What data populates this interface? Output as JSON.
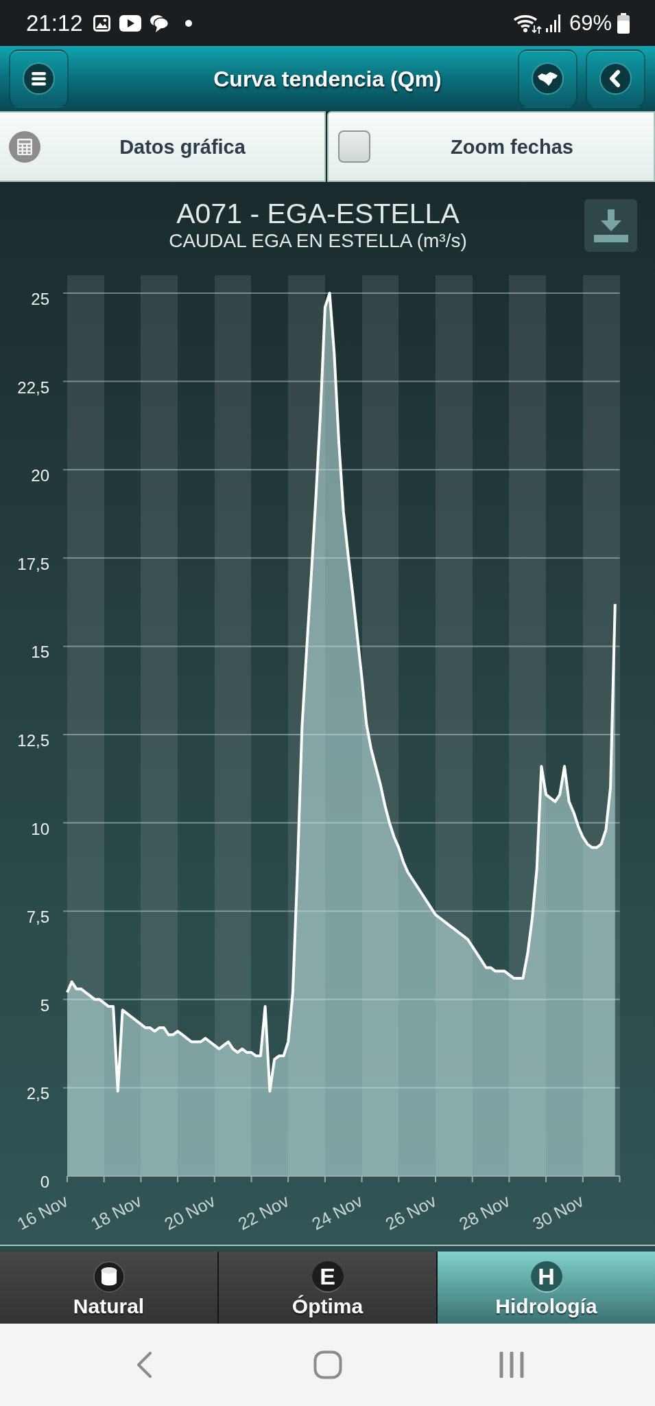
{
  "status_bar": {
    "time": "21:12",
    "battery": "69%"
  },
  "header": {
    "title": "Curva tendencia (Qm)"
  },
  "toolbar": {
    "data_button": {
      "label": "Datos gráfica"
    },
    "zoom_toggle": {
      "label": "Zoom fechas",
      "checked": false
    }
  },
  "chart": {
    "title": "A071 - EGA-ESTELLA",
    "subtitle": "CAUDAL EGA EN ESTELLA (m³/s)",
    "chart_data": {
      "type": "area",
      "categories": [
        "16 Nov",
        null,
        null,
        null,
        null,
        null,
        null,
        null,
        null,
        null,
        null,
        null,
        null,
        null,
        null,
        null,
        "18 Nov",
        null,
        null,
        null,
        null,
        null,
        null,
        null,
        null,
        null,
        null,
        null,
        null,
        null,
        null,
        null,
        "20 Nov",
        null,
        null,
        null,
        null,
        null,
        null,
        null,
        null,
        null,
        null,
        null,
        null,
        null,
        null,
        null,
        "22 Nov",
        null,
        null,
        null,
        null,
        null,
        null,
        null,
        null,
        null,
        null,
        null,
        null,
        null,
        null,
        null,
        "24 Nov",
        null,
        null,
        null,
        null,
        null,
        null,
        null,
        null,
        null,
        null,
        null,
        null,
        null,
        null,
        null,
        "26 Nov",
        null,
        null,
        null,
        null,
        null,
        null,
        null,
        null,
        null,
        null,
        null,
        null,
        null,
        null,
        null,
        "28 Nov",
        null,
        null,
        null,
        null,
        null,
        null,
        null,
        null,
        null,
        null,
        null,
        null,
        null,
        null,
        null,
        "30 Nov",
        null,
        null,
        null,
        null,
        null,
        null,
        null
      ],
      "series": [
        {
          "color": "#ffffff",
          "values": [
            5.2,
            5.5,
            5.3,
            5.3,
            5.2,
            5.1,
            5.0,
            5.0,
            4.9,
            4.8,
            4.8,
            2.4,
            4.7,
            4.6,
            4.5,
            4.4,
            4.3,
            4.2,
            4.2,
            4.1,
            4.2,
            4.2,
            4.0,
            4.0,
            4.1,
            4.0,
            3.9,
            3.8,
            3.8,
            3.8,
            3.9,
            3.8,
            3.7,
            3.6,
            3.7,
            3.8,
            3.6,
            3.5,
            3.6,
            3.5,
            3.5,
            3.4,
            3.4,
            4.8,
            2.4,
            3.3,
            3.4,
            3.4,
            3.8,
            5.2,
            8.6,
            12.7,
            14.9,
            17.0,
            19.2,
            21.6,
            24.6,
            25,
            23.3,
            20.8,
            18.8,
            17.6,
            16.5,
            15.3,
            14.1,
            12.8,
            12.1,
            11.6,
            11.1,
            10.5,
            10.0,
            9.6,
            9.3,
            8.9,
            8.6,
            8.4,
            8.2,
            8.0,
            7.8,
            7.6,
            7.4,
            7.3,
            7.2,
            7.1,
            7.0,
            6.9,
            6.8,
            6.7,
            6.5,
            6.3,
            6.1,
            5.9,
            5.9,
            5.8,
            5.8,
            5.8,
            5.7,
            5.6,
            5.6,
            5.6,
            6.3,
            7.3,
            8.7,
            11.6,
            10.8,
            10.7,
            10.6,
            10.8,
            11.6,
            10.6,
            10.3,
            9.9,
            9.6,
            9.4,
            9.3,
            9.3,
            9.4,
            9.8,
            11.0,
            16.2
          ]
        }
      ],
      "ylim": [
        0,
        25
      ],
      "grid": true,
      "yticks": [
        0,
        {
          "value": 2.5,
          "label": "2,5"
        },
        5,
        {
          "value": 7.5,
          "label": "7,5"
        },
        10,
        {
          "value": 12.5,
          "label": "12,5"
        },
        15,
        {
          "value": 17.5,
          "label": "17,5"
        },
        20,
        {
          "value": 22.5,
          "label": "22,5"
        },
        25
      ]
    }
  },
  "tabs": [
    {
      "label": "Natural",
      "kind": "icon",
      "selected": false
    },
    {
      "label": "Óptima",
      "kind": "letter",
      "letter": "E",
      "selected": false
    },
    {
      "label": "Hidrología",
      "kind": "letter",
      "letter": "H",
      "selected": true
    }
  ]
}
